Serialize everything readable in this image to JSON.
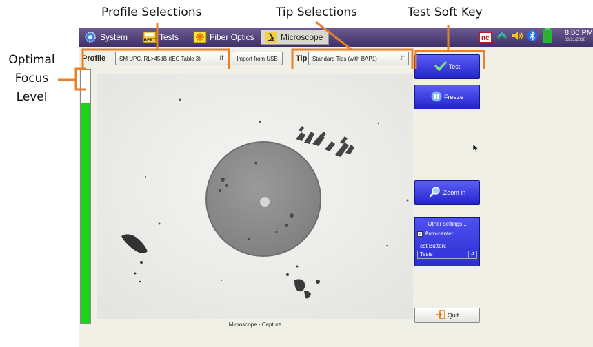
{
  "annotations": {
    "profile_selections": "Profile Selections",
    "tip_selections": "Tip Selections",
    "test_soft_key": "Test Soft Key",
    "optimal_focus": [
      "Optimal",
      "Focus",
      "Level"
    ]
  },
  "topbar": {
    "tabs": [
      {
        "label": "System",
        "icon": "gear-icon"
      },
      {
        "label": "Tests",
        "icon": "bert-icon",
        "icon_text": "BERT"
      },
      {
        "label": "Fiber Optics",
        "icon": "starburst-icon"
      },
      {
        "label": "Microscope",
        "icon": "microscope-icon"
      }
    ],
    "active_tab": "Microscope",
    "tray_badge": "nc",
    "clock_time": "8:00 PM",
    "clock_date": "03/21/2018"
  },
  "toolbar": {
    "profile_label": "Profile",
    "profile_value": "SM UPC, RL>45dB (IEC Table 3)",
    "import_label": "Import from USB",
    "tip_label": "Tip",
    "tip_value": "Standard Tips (with BAP1)"
  },
  "focus_level": 0.87,
  "view": {
    "caption": "Microscope - Capture"
  },
  "buttons": {
    "test": "Test",
    "freeze": "Freeze",
    "zoom_in": "Zoom in",
    "quit": "Quit"
  },
  "other_settings": {
    "title": "Other settings...",
    "auto_center_label": "Auto-center",
    "auto_center_checked": true,
    "test_button_label": "Test Button:",
    "test_button_value": "Tests"
  },
  "colors": {
    "topbar": "#3f3168",
    "button_blue": "#2a2dd0",
    "focus_green": "#1ed11a",
    "annotation_orange": "#e8802a"
  }
}
